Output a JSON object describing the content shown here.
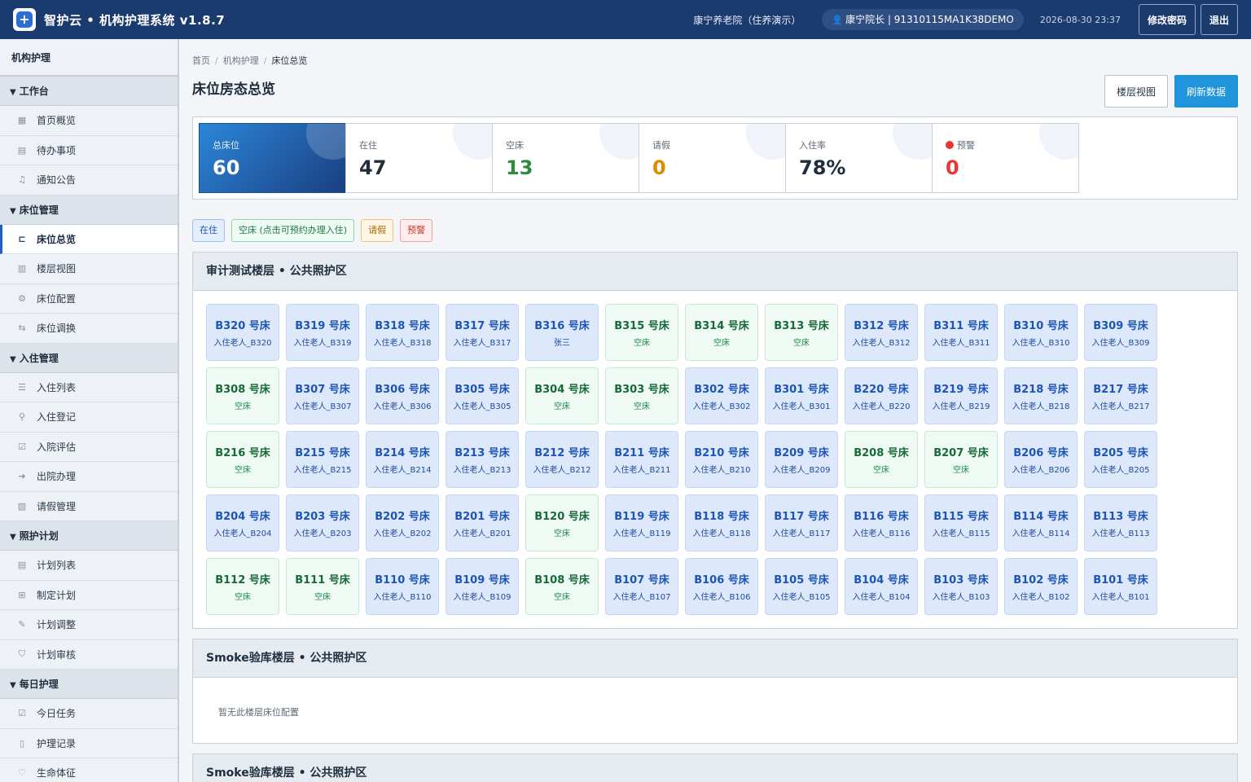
{
  "app": {
    "logo_glyph": "+",
    "title": "智护云 • 机构护理系统 v1.8.7",
    "org": "康宁养老院（住养演示）",
    "user": "康宁院长 | 91310115MA1K38DEMO",
    "datetime": "2026-08-30 23:37",
    "change_password": "修改密码",
    "logout": "退出"
  },
  "sidebar": {
    "title": "机构护理",
    "groups": [
      {
        "label": "工作台",
        "items": [
          {
            "label": "首页概览",
            "icon": "grid-icon"
          },
          {
            "label": "待办事项",
            "icon": "clipboard-icon"
          },
          {
            "label": "通知公告",
            "icon": "bell-icon"
          }
        ]
      },
      {
        "label": "床位管理",
        "items": [
          {
            "label": "床位总览",
            "icon": "bed-icon",
            "active": true
          },
          {
            "label": "楼层视图",
            "icon": "building-icon"
          },
          {
            "label": "床位配置",
            "icon": "gear-icon"
          },
          {
            "label": "床位调换",
            "icon": "swap-icon"
          }
        ]
      },
      {
        "label": "入住管理",
        "items": [
          {
            "label": "入住列表",
            "icon": "list-icon"
          },
          {
            "label": "入住登记",
            "icon": "user-add-icon"
          },
          {
            "label": "入院评估",
            "icon": "checklist-icon"
          },
          {
            "label": "出院办理",
            "icon": "exit-icon"
          },
          {
            "label": "请假管理",
            "icon": "calendar-icon"
          }
        ]
      },
      {
        "label": "照护计划",
        "items": [
          {
            "label": "计划列表",
            "icon": "clipboard-icon"
          },
          {
            "label": "制定计划",
            "icon": "doc-add-icon"
          },
          {
            "label": "计划调整",
            "icon": "pencil-icon"
          },
          {
            "label": "计划审核",
            "icon": "shield-icon"
          }
        ]
      },
      {
        "label": "每日护理",
        "items": [
          {
            "label": "今日任务",
            "icon": "check-icon"
          },
          {
            "label": "护理记录",
            "icon": "book-icon"
          },
          {
            "label": "生命体征",
            "icon": "heart-icon"
          }
        ]
      }
    ]
  },
  "breadcrumb": [
    "首页",
    "机构护理",
    "床位总览"
  ],
  "page": {
    "title": "床位房态总览",
    "floor_view_btn": "楼层视图",
    "refresh_btn": "刷新数据"
  },
  "stats": [
    {
      "label": "总床位",
      "value": "60",
      "color": "#ffffff"
    },
    {
      "label": "在住",
      "value": "47",
      "color": "#1f2d3d"
    },
    {
      "label": "空床",
      "value": "13",
      "color": "#2e8b3e"
    },
    {
      "label": "请假",
      "value": "0",
      "color": "#e08a00"
    },
    {
      "label": "入住率",
      "value": "78%",
      "color": "#1f2d3d"
    },
    {
      "label": "预警",
      "value": "0",
      "color": "#e53935",
      "dot": true
    }
  ],
  "legend": {
    "occupied": "在住",
    "empty": "空床 (点击可预约办理入住)",
    "leave": "请假",
    "warning": "预警"
  },
  "floors": [
    {
      "title": "审计测试楼层 • 公共照护区",
      "beds": [
        {
          "no": "B320 号床",
          "who": "入住老人_B320",
          "status": "occupied"
        },
        {
          "no": "B319 号床",
          "who": "入住老人_B319",
          "status": "occupied"
        },
        {
          "no": "B318 号床",
          "who": "入住老人_B318",
          "status": "occupied"
        },
        {
          "no": "B317 号床",
          "who": "入住老人_B317",
          "status": "occupied"
        },
        {
          "no": "B316 号床",
          "who": "张三",
          "status": "occupied"
        },
        {
          "no": "B315 号床",
          "who": "空床",
          "status": "empty"
        },
        {
          "no": "B314 号床",
          "who": "空床",
          "status": "empty"
        },
        {
          "no": "B313 号床",
          "who": "空床",
          "status": "empty"
        },
        {
          "no": "B312 号床",
          "who": "入住老人_B312",
          "status": "occupied"
        },
        {
          "no": "B311 号床",
          "who": "入住老人_B311",
          "status": "occupied"
        },
        {
          "no": "B310 号床",
          "who": "入住老人_B310",
          "status": "occupied"
        },
        {
          "no": "B309 号床",
          "who": "入住老人_B309",
          "status": "occupied"
        },
        {
          "no": "B308 号床",
          "who": "空床",
          "status": "empty"
        },
        {
          "no": "B307 号床",
          "who": "入住老人_B307",
          "status": "occupied"
        },
        {
          "no": "B306 号床",
          "who": "入住老人_B306",
          "status": "occupied"
        },
        {
          "no": "B305 号床",
          "who": "入住老人_B305",
          "status": "occupied"
        },
        {
          "no": "B304 号床",
          "who": "空床",
          "status": "empty"
        },
        {
          "no": "B303 号床",
          "who": "空床",
          "status": "empty"
        },
        {
          "no": "B302 号床",
          "who": "入住老人_B302",
          "status": "occupied"
        },
        {
          "no": "B301 号床",
          "who": "入住老人_B301",
          "status": "occupied"
        },
        {
          "no": "B220 号床",
          "who": "入住老人_B220",
          "status": "occupied"
        },
        {
          "no": "B219 号床",
          "who": "入住老人_B219",
          "status": "occupied"
        },
        {
          "no": "B218 号床",
          "who": "入住老人_B218",
          "status": "occupied"
        },
        {
          "no": "B217 号床",
          "who": "入住老人_B217",
          "status": "occupied"
        },
        {
          "no": "B216 号床",
          "who": "空床",
          "status": "empty"
        },
        {
          "no": "B215 号床",
          "who": "入住老人_B215",
          "status": "occupied"
        },
        {
          "no": "B214 号床",
          "who": "入住老人_B214",
          "status": "occupied"
        },
        {
          "no": "B213 号床",
          "who": "入住老人_B213",
          "status": "occupied"
        },
        {
          "no": "B212 号床",
          "who": "入住老人_B212",
          "status": "occupied"
        },
        {
          "no": "B211 号床",
          "who": "入住老人_B211",
          "status": "occupied"
        },
        {
          "no": "B210 号床",
          "who": "入住老人_B210",
          "status": "occupied"
        },
        {
          "no": "B209 号床",
          "who": "入住老人_B209",
          "status": "occupied"
        },
        {
          "no": "B208 号床",
          "who": "空床",
          "status": "empty"
        },
        {
          "no": "B207 号床",
          "who": "空床",
          "status": "empty"
        },
        {
          "no": "B206 号床",
          "who": "入住老人_B206",
          "status": "occupied"
        },
        {
          "no": "B205 号床",
          "who": "入住老人_B205",
          "status": "occupied"
        },
        {
          "no": "B204 号床",
          "who": "入住老人_B204",
          "status": "occupied"
        },
        {
          "no": "B203 号床",
          "who": "入住老人_B203",
          "status": "occupied"
        },
        {
          "no": "B202 号床",
          "who": "入住老人_B202",
          "status": "occupied"
        },
        {
          "no": "B201 号床",
          "who": "入住老人_B201",
          "status": "occupied"
        },
        {
          "no": "B120 号床",
          "who": "空床",
          "status": "empty"
        },
        {
          "no": "B119 号床",
          "who": "入住老人_B119",
          "status": "occupied"
        },
        {
          "no": "B118 号床",
          "who": "入住老人_B118",
          "status": "occupied"
        },
        {
          "no": "B117 号床",
          "who": "入住老人_B117",
          "status": "occupied"
        },
        {
          "no": "B116 号床",
          "who": "入住老人_B116",
          "status": "occupied"
        },
        {
          "no": "B115 号床",
          "who": "入住老人_B115",
          "status": "occupied"
        },
        {
          "no": "B114 号床",
          "who": "入住老人_B114",
          "status": "occupied"
        },
        {
          "no": "B113 号床",
          "who": "入住老人_B113",
          "status": "occupied"
        },
        {
          "no": "B112 号床",
          "who": "空床",
          "status": "empty"
        },
        {
          "no": "B111 号床",
          "who": "空床",
          "status": "empty"
        },
        {
          "no": "B110 号床",
          "who": "入住老人_B110",
          "status": "occupied"
        },
        {
          "no": "B109 号床",
          "who": "入住老人_B109",
          "status": "occupied"
        },
        {
          "no": "B108 号床",
          "who": "空床",
          "status": "empty"
        },
        {
          "no": "B107 号床",
          "who": "入住老人_B107",
          "status": "occupied"
        },
        {
          "no": "B106 号床",
          "who": "入住老人_B106",
          "status": "occupied"
        },
        {
          "no": "B105 号床",
          "who": "入住老人_B105",
          "status": "occupied"
        },
        {
          "no": "B104 号床",
          "who": "入住老人_B104",
          "status": "occupied"
        },
        {
          "no": "B103 号床",
          "who": "入住老人_B103",
          "status": "occupied"
        },
        {
          "no": "B102 号床",
          "who": "入住老人_B102",
          "status": "occupied"
        },
        {
          "no": "B101 号床",
          "who": "入住老人_B101",
          "status": "occupied"
        }
      ]
    },
    {
      "title": "Smoke验库楼层 • 公共照护区",
      "beds": [],
      "empty_text": "暂无此楼层床位配置"
    },
    {
      "title": "Smoke验库楼层 • 公共照护区",
      "beds": []
    }
  ]
}
